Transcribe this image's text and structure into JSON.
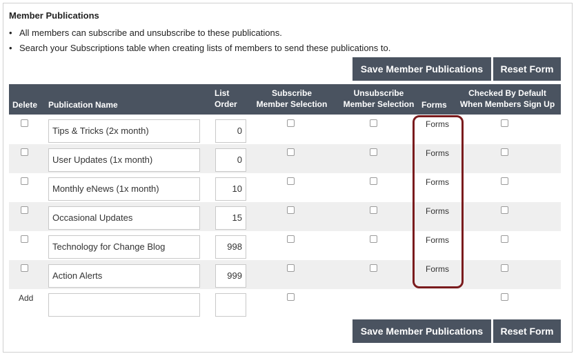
{
  "section": {
    "title": "Member Publications",
    "bullets": [
      "All members can subscribe and unsubscribe to these publications.",
      "Search your Subscriptions table when creating lists of members to send these publications to."
    ]
  },
  "buttons": {
    "save_label": "Save Member Publications",
    "reset_label": "Reset Form"
  },
  "table": {
    "headers": {
      "delete": "Delete",
      "name": "Publication Name",
      "order_line1": "List",
      "order_line2": "Order",
      "subscribe_line1": "Subscribe",
      "subscribe_line2": "Member Selection",
      "unsubscribe_line1": "Unsubscribe",
      "unsubscribe_line2": "Member Selection",
      "forms": "Forms",
      "default_line1": "Checked By Default",
      "default_line2": "When Members Sign Up"
    },
    "rows": [
      {
        "name": "Tips & Tricks (2x month)",
        "order": "0",
        "forms": "Forms"
      },
      {
        "name": "User Updates (1x month)",
        "order": "0",
        "forms": "Forms"
      },
      {
        "name": "Monthly eNews (1x month)",
        "order": "10",
        "forms": "Forms"
      },
      {
        "name": "Occasional Updates",
        "order": "15",
        "forms": "Forms"
      },
      {
        "name": "Technology for Change Blog",
        "order": "998",
        "forms": "Forms"
      },
      {
        "name": "Action Alerts",
        "order": "999",
        "forms": "Forms"
      }
    ],
    "add_label": "Add"
  },
  "colors": {
    "header_bg": "#4a5360",
    "button_bg": "#4a5360",
    "highlight_border": "#7a1b1d",
    "row_alt": "#efefef"
  }
}
